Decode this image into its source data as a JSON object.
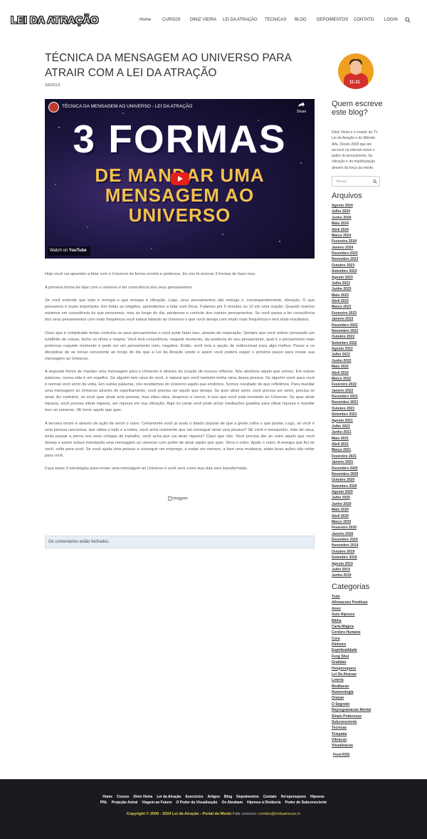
{
  "header": {
    "logo": "LEI DA ATRAÇÃO",
    "nav": [
      "Home",
      "CURSOS",
      "DINIZ VIEIRA",
      "LEI DA ATRAÇÃO",
      "TECNICAS",
      "BLOG",
      "DEPOIMENTOS",
      "CONTATO",
      "LOGIN"
    ],
    "search_icon": "search-icon"
  },
  "post": {
    "title": "TÉCNICA DA MENSAGEM AO UNIVERSO PARA ATRAIR COM A LEI DA ATRAÇÃO",
    "date": "3/8/2019",
    "video": {
      "title": "TÉCNICA DA MENSAGEM AO UNIVERSO - LEI DA ATRAÇÃO",
      "share": "Share",
      "big_line1": "3 FORMAS",
      "big_line2": "DE MANDAR UMA",
      "big_line3": "MENSAGEM AO",
      "big_line4": "UNIVERSO",
      "watch_on": "Watch on",
      "youtube": "YouTube"
    },
    "paragraphs": [
      "Hoje você vai aprender a falar com o Universo da forma correta e poderosa. Eu vou te ensinar 3 formas de fazer isso.",
      "A primeira forma de falar com o universo é ter consciência dos seus pensamentos.",
      "Se você entende que tudo é energia e que energia é vibração. Logo, seus pensamentos são energia e, consequentemente, vibração. O que pensamos é muito importante. Em todas as religiões, aprendemos a falar com Deus. Falamos por 5 minutos ou 10 em uma oração. Quando oramos estamos em consciência do que pensamos, mas ao longo do dia, perdemos o controle dos nossos pensamentos. Se você passa a ter consciência dos seus pensamentos com mais frequência você estará falando ao Universo  o que você deseja com muito mais frequência e terá mais resultados.",
      "Claro que é complicado tentar controlar os seus pensamentos e você pode fazer isso, através da respiração. Sempre que você estiver pensando um turbilhão de coisas, feche os olhos e respire. Você terá consciência, naquele momento, da essência do seu pensamento, qual é o pensamento mais poderoso naquele momento e pode ser um pensamento ruim, negativo. Então, você terá a opção de redirecionar para algo melhor. Passe a se disciplinar de se tornar consciente ao longo do dia que a Lei da Atração existe e assim você poderá seguir o próximo passo para enviar sua mensagem ao Universo.",
      "A segunda forma de mandar uma mensagem para o Universo é através da criação de nossos reflexos. Nós atraímos aquilo que somos. Em outras palavras, nossa vida é um espelho. Se alguém tem raiva de você, é natural que você também tenha raiva dessa pessoa. Se alguém sorrir para você é normal você sorrir de volta. Em outras palavras, nós recebemos do Universo aquilo que emitimos. Somos resultado do que refletimos. Para mandar uma mensagem ao Universo através do espelhamento, você precisa ser aquilo que deseja. Se quer atrair amor, você precisa ser amor, precisa se amar. Ao contrário, se você quer atrair uma pessoa, mas vibra raiva, desprezo e rancor, é isso que você está enviando ao Universo. Se quer atrair riqueza, você precisa vibrar riqueza, ser riqueza em sua vibração. Aqui no canal você pode achar mediações guiadas para vibrar riqueza e mandar isso ao universo. SE torne aquilo que quer.",
      "A terceira foram é através de ação de servir o outro. Certamente você já ouviu o ditado popular de que a gente colhe o que planta. Logo, se você é uma pessoa rancorosa, que odeia a tudo e a todos, você acha realmente que vai conseguir atrair uma pessoa? SE você é mesquinho, mão de vaca, tenta passar a perna nos seus colegas de trabalho, você acha que vai atrair riqueza? Claro que não. Você precisa dar ao outro aquilo que você deseja e assim estará mandando uma mensagem ao universo com poder de atrair aquilo que quer. Sirva o outro. Ajude o outro. A energia que flui de você, volta para você. Se você ajuda uma pessoa a conseguir um emprego, a reatar um namoro, a faze uma mudança, estas boas ações vão voltar para você.",
      "Faça estas 3 estratégias para enviar uma mensagem ao Universo e você verá como sua vida será transformada."
    ],
    "image_alt": "Imagem",
    "comments_closed": "Os comentários estão fechados."
  },
  "sidebar": {
    "who_heading": "Quem escreve este blog?",
    "who_text": "Diniz Vieira é o criador da TV Lei da Atração e do Método Alfa. Desde 2009 que ele escreve na internet sobre o poder do pensamento, da vibração e da manifestação através da força da mente.",
    "photo_badge": "11:11",
    "search_placeholder": "Busca",
    "archives_heading": "Arquivos",
    "archives": [
      "Agosto 2024",
      "Julho 2024",
      "Junho 2024",
      "Maio 2024",
      "Abril 2024",
      "Março 2024",
      "Fevereiro 2024",
      "Janeiro 2024",
      "Dezembro 2023",
      "Novembro 2023",
      "Outubro 2023",
      "Setembro 2023",
      "Agosto 2023",
      "Julho 2023",
      "Junho 2023",
      "Maio 2023",
      "Abril 2023",
      "Março 2023",
      "Fevereiro 2023",
      "Janeiro 2023",
      "Dezembro 2022",
      "Novembro 2022",
      "Outubro 2022",
      "Setembro 2022",
      "Agosto 2022",
      "Julho 2022",
      "Junho 2022",
      "Maio 2022",
      "Abril 2022",
      "Março 2022",
      "Fevereiro 2022",
      "Janeiro 2022",
      "Dezembro 2021",
      "Novembro 2021",
      "Outubro 2021",
      "Setembro 2021",
      "Agosto 2021",
      "Julho 2021",
      "Junho 2021",
      "Maio 2021",
      "Abril 2021",
      "Março 2021",
      "Fevereiro 2021",
      "Janeiro 2021",
      "Dezembro 2020",
      "Novembro 2020",
      "Outubro 2020",
      "Setembro 2020",
      "Agosto 2020",
      "Julho 2020",
      "Junho 2020",
      "Maio 2020",
      "Abril 2020",
      "Março 2020",
      "Fevereiro 2020",
      "Janeiro 2020",
      "Dezembro 2019",
      "Novembro 2019",
      "Outubro 2019",
      "Setembro 2019",
      "Agosto 2019",
      "Julho 2019",
      "Junho 2019"
    ],
    "categories_heading": "Categorias",
    "categories": [
      "Tudo",
      "Afirmacoes Positivas",
      "Amor",
      "Auto Hipnose",
      "Biblia",
      "Carta Magica",
      "Cerebro Humano",
      "Cura",
      "Dinheiro",
      "Espiritualidade",
      "Feng Shui",
      "Gratidao",
      "Hooponopono",
      "Lei Da Atracao",
      "Loteria",
      "Meditacao",
      "Numerologia",
      "Oracao",
      "O Segredo",
      "Reprogramacao Mental",
      "Sinais Poderosos",
      "Subconsciente",
      "Tecnicas",
      "Telepatia",
      "Vibracao",
      "Visualizacao"
    ],
    "feed": "Feed RSS"
  },
  "footer": {
    "row1": [
      "Home",
      "Cursos",
      "Diniz Vieira",
      "Lei da Atração",
      "Exercícios",
      "Artigos",
      "Blog",
      "Depoimentos",
      "Contato",
      "Ho'oponopono",
      "Hipnose"
    ],
    "row2": [
      "PNL",
      "Projeção Astral",
      "Viagem ao Futuro",
      "O Poder da Visualização",
      "Os Abraham",
      "Hipnose à Distância",
      "Poder do Subconsciente"
    ],
    "copyright": "Copyright © 2009 - 2024 Lei da Atração - Portal da Mente",
    "contact_label": "Fale conosco:",
    "contact_email": "contato@leidaatracao.tv"
  },
  "colors": {
    "footer_bg": "#1b1b1f",
    "copyright": "#e6d44a",
    "video_title_yellow": "#f3c14b",
    "youtube_red": "#e62117",
    "comments_bg": "#e8eef6"
  }
}
